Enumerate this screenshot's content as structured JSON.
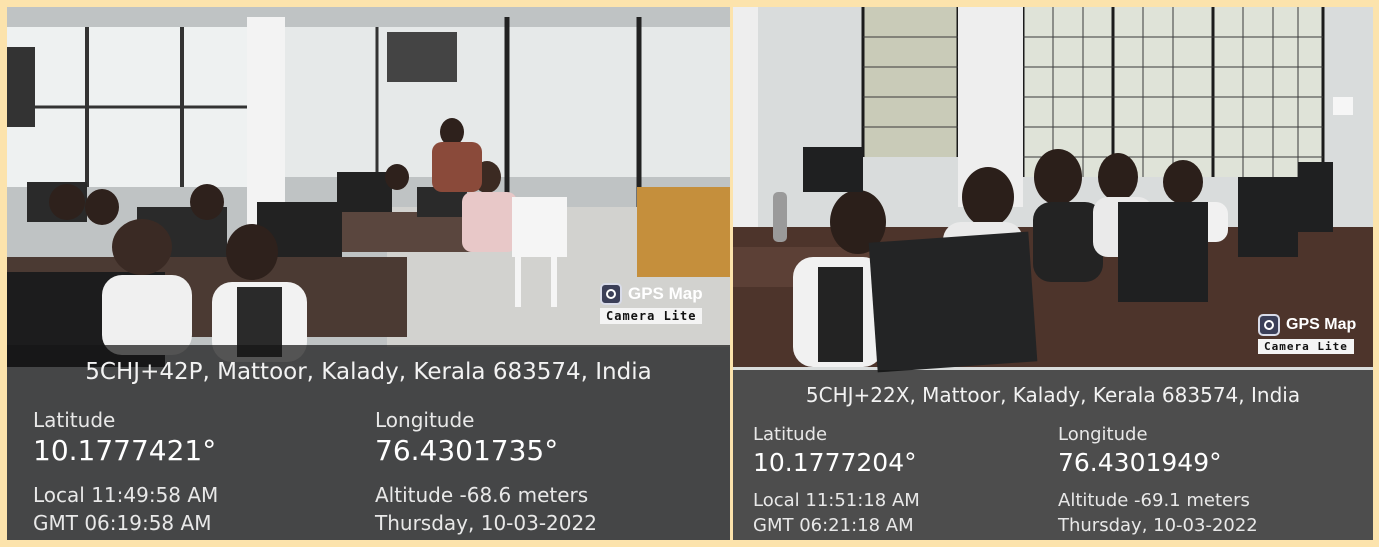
{
  "photos": [
    {
      "address": "5CHJ+42P, Mattoor, Kalady, Kerala 683574, India",
      "latitude_label": "Latitude",
      "latitude_value": "10.1777421°",
      "longitude_label": "Longitude",
      "longitude_value": "76.4301735°",
      "local_time": "Local 11:49:58 AM",
      "gmt_time": "GMT 06:19:58 AM",
      "altitude": "Altitude -68.6 meters",
      "date": "Thursday, 10-03-2022",
      "watermark_title": "GPS Map",
      "watermark_subtitle": "Camera Lite"
    },
    {
      "address": "5CHJ+22X, Mattoor, Kalady, Kerala 683574, India",
      "latitude_label": "Latitude",
      "latitude_value": "10.1777204°",
      "longitude_label": "Longitude",
      "longitude_value": "76.4301949°",
      "local_time": "Local 11:51:18 AM",
      "gmt_time": "GMT 06:21:18 AM",
      "altitude": "Altitude -69.1 meters",
      "date": "Thursday, 10-03-2022",
      "watermark_title": "GPS Map",
      "watermark_subtitle": "Camera Lite"
    }
  ],
  "colors": {
    "frame": "#fce3ac",
    "overlay": "#161616",
    "overlay_text": "#ffffff"
  }
}
